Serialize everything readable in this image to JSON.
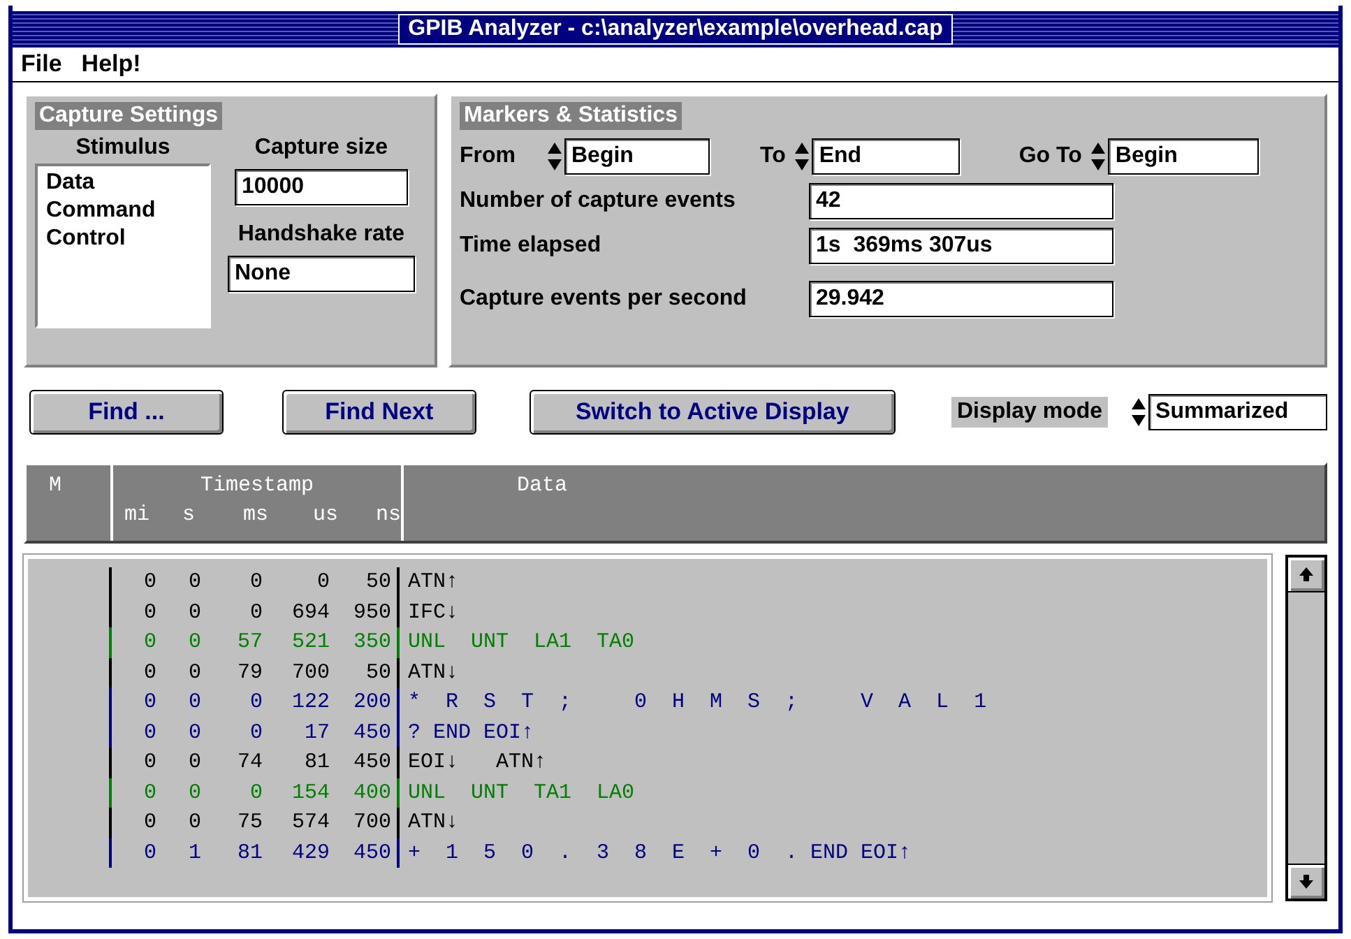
{
  "window": {
    "title": "GPIB Analyzer - c:\\analyzer\\example\\overhead.cap"
  },
  "menu": [
    "File",
    "Help!"
  ],
  "capture_settings": {
    "title": "Capture Settings",
    "stimulus_label": "Stimulus",
    "stimulus_items": [
      "Data",
      "Command",
      "Control"
    ],
    "capture_size_label": "Capture size",
    "capture_size": "10000",
    "handshake_label": "Handshake rate",
    "handshake": "None"
  },
  "markers": {
    "title": "Markers & Statistics",
    "from_label": "From",
    "from": "Begin",
    "to_label": "To",
    "to": "End",
    "goto_label": "Go To",
    "goto": "Begin",
    "stats": [
      {
        "label": "Number of capture events",
        "value": "42"
      },
      {
        "label": "Time elapsed",
        "value": "1s  369ms 307us"
      },
      {
        "label": "Capture events per second",
        "value": "29.942"
      }
    ]
  },
  "buttons": [
    "Find ...",
    "Find Next",
    "Switch to Active Display"
  ],
  "display_mode": {
    "label": "Display mode",
    "value": "Summarized"
  },
  "table": {
    "columns": [
      "M",
      "Timestamp",
      "Data"
    ],
    "subcolumns": [
      "mi",
      "s",
      "ms",
      "us",
      "ns"
    ],
    "rows": [
      {
        "kind": "control",
        "time": [
          "0",
          "0",
          "0",
          "0",
          "50"
        ],
        "data": "ATN↑"
      },
      {
        "kind": "control",
        "time": [
          "0",
          "0",
          "0",
          "694",
          "950"
        ],
        "data": "IFC↓"
      },
      {
        "kind": "address",
        "time": [
          "0",
          "0",
          "57",
          "521",
          "350"
        ],
        "data": "UNL  UNT  LA1  TA0"
      },
      {
        "kind": "control",
        "time": [
          "0",
          "0",
          "79",
          "700",
          "50"
        ],
        "data": "ATN↓"
      },
      {
        "kind": "data",
        "time": [
          "0",
          "0",
          "0",
          "122",
          "200"
        ],
        "data": "*  R  S  T  ;     0  H  M  S  ;     V  A  L  1"
      },
      {
        "kind": "data",
        "time": [
          "0",
          "0",
          "0",
          "17",
          "450"
        ],
        "data": "? END EOI↑"
      },
      {
        "kind": "control",
        "time": [
          "0",
          "0",
          "74",
          "81",
          "450"
        ],
        "data": "EOI↓   ATN↑"
      },
      {
        "kind": "address",
        "time": [
          "0",
          "0",
          "0",
          "154",
          "400"
        ],
        "data": "UNL  UNT  TA1  LA0"
      },
      {
        "kind": "control",
        "time": [
          "0",
          "0",
          "75",
          "574",
          "700"
        ],
        "data": "ATN↓"
      },
      {
        "kind": "data",
        "time": [
          "0",
          "1",
          "81",
          "429",
          "450"
        ],
        "data": "+  1  5  0  .  3  8  E  +  0  . END EOI↑"
      }
    ]
  }
}
